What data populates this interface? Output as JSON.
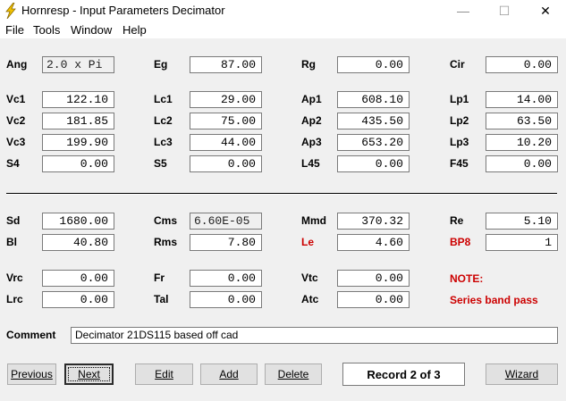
{
  "window": {
    "title": "Hornresp - Input Parameters   Decimator",
    "min_glyph": "—",
    "max_glyph": "☐",
    "close_glyph": "✕"
  },
  "menu": [
    "File",
    "Tools",
    "Window",
    "Help"
  ],
  "params": {
    "ang": {
      "label": "Ang",
      "value": "2.0 x Pi"
    },
    "eg": {
      "label": "Eg",
      "value": "87.00"
    },
    "rg": {
      "label": "Rg",
      "value": "0.00"
    },
    "cir": {
      "label": "Cir",
      "value": "0.00"
    },
    "vc1": {
      "label": "Vc1",
      "value": "122.10"
    },
    "lc1": {
      "label": "Lc1",
      "value": "29.00"
    },
    "ap1": {
      "label": "Ap1",
      "value": "608.10"
    },
    "lp1": {
      "label": "Lp1",
      "value": "14.00"
    },
    "vc2": {
      "label": "Vc2",
      "value": "181.85"
    },
    "lc2": {
      "label": "Lc2",
      "value": "75.00"
    },
    "ap2": {
      "label": "Ap2",
      "value": "435.50"
    },
    "lp2": {
      "label": "Lp2",
      "value": "63.50"
    },
    "vc3": {
      "label": "Vc3",
      "value": "199.90"
    },
    "lc3": {
      "label": "Lc3",
      "value": "44.00"
    },
    "ap3": {
      "label": "Ap3",
      "value": "653.20"
    },
    "lp3": {
      "label": "Lp3",
      "value": "10.20"
    },
    "s4": {
      "label": "S4",
      "value": "0.00"
    },
    "s5": {
      "label": "S5",
      "value": "0.00"
    },
    "l45": {
      "label": "L45",
      "value": "0.00"
    },
    "f45": {
      "label": "F45",
      "value": "0.00"
    },
    "sd": {
      "label": "Sd",
      "value": "1680.00"
    },
    "cms": {
      "label": "Cms",
      "value": "6.60E-05"
    },
    "mmd": {
      "label": "Mmd",
      "value": "370.32"
    },
    "re": {
      "label": "Re",
      "value": "5.10"
    },
    "bl": {
      "label": "Bl",
      "value": "40.80"
    },
    "rms": {
      "label": "Rms",
      "value": "7.80"
    },
    "le": {
      "label": "Le",
      "value": "4.60"
    },
    "bp8": {
      "label": "BP8",
      "value": "1"
    },
    "vrc": {
      "label": "Vrc",
      "value": "0.00"
    },
    "fr": {
      "label": "Fr",
      "value": "0.00"
    },
    "vtc": {
      "label": "Vtc",
      "value": "0.00"
    },
    "lrc": {
      "label": "Lrc",
      "value": "0.00"
    },
    "tal": {
      "label": "Tal",
      "value": "0.00"
    },
    "atc": {
      "label": "Atc",
      "value": "0.00"
    }
  },
  "note": {
    "label": "NOTE:",
    "text": "Series band pass"
  },
  "comment": {
    "label": "Comment",
    "value": "Decimator 21DS115 based off cad"
  },
  "buttons": {
    "previous": "Previous",
    "next": "Next",
    "edit": "Edit",
    "add": "Add",
    "delete": "Delete",
    "wizard": "Wizard"
  },
  "record": "Record 2 of 3",
  "colors": {
    "accent_red": "#cc0000",
    "client_bg": "#f0f0f0"
  },
  "icons": {
    "app": "lightning-bolt-icon"
  }
}
